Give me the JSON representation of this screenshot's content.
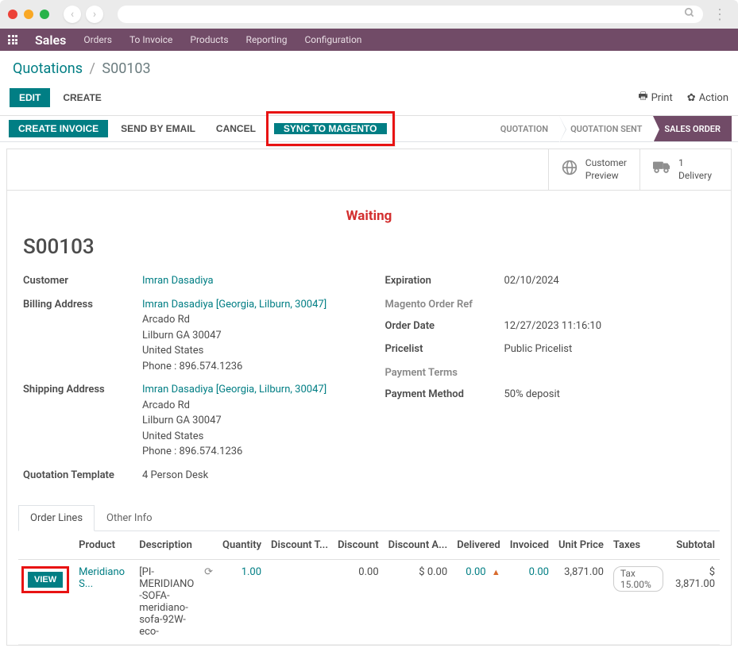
{
  "topnav": {
    "brand": "Sales",
    "items": [
      "Orders",
      "To Invoice",
      "Products",
      "Reporting",
      "Configuration"
    ]
  },
  "breadcrumb": {
    "root": "Quotations",
    "current": "S00103"
  },
  "controls": {
    "edit": "EDIT",
    "create": "CREATE",
    "print": "Print",
    "action": "Action"
  },
  "actions": {
    "create_invoice": "CREATE INVOICE",
    "send_email": "SEND BY EMAIL",
    "cancel": "CANCEL",
    "sync": "SYNC TO MAGENTO"
  },
  "status_steps": {
    "quotation": "QUOTATION",
    "sent": "QUOTATION SENT",
    "order": "SALES ORDER"
  },
  "sheet_header": {
    "preview_label": "Customer",
    "preview_sub": "Preview",
    "delivery_count": "1",
    "delivery_label": "Delivery"
  },
  "waiting": "Waiting",
  "order_name": "S00103",
  "fields": {
    "customer_label": "Customer",
    "customer_value": "Imran Dasadiya",
    "billing_label": "Billing Address",
    "shipping_label": "Shipping Address",
    "addr_name_link": "Imran Dasadiya",
    "addr_sub": "[Georgia, Lilburn, 30047]",
    "addr_line1": "Arcado Rd",
    "addr_line2": "Lilburn GA 30047",
    "addr_country": "United States",
    "addr_phone": "Phone : 896.574.1236",
    "template_label": "Quotation Template",
    "template_value": "4 Person Desk",
    "expiration_label": "Expiration",
    "expiration_value": "02/10/2024",
    "magento_ref_label": "Magento Order Ref",
    "order_date_label": "Order Date",
    "order_date_value": "12/27/2023 11:16:10",
    "pricelist_label": "Pricelist",
    "pricelist_value": "Public Pricelist",
    "payment_terms_label": "Payment Terms",
    "payment_method_label": "Payment Method",
    "payment_method_value": "50% deposit"
  },
  "tabs": {
    "order_lines": "Order Lines",
    "other_info": "Other Info"
  },
  "table": {
    "headers": {
      "product": "Product",
      "description": "Description",
      "quantity": "Quantity",
      "discount_t": "Discount T...",
      "discount": "Discount",
      "discount_a": "Discount A...",
      "delivered": "Delivered",
      "invoiced": "Invoiced",
      "unit_price": "Unit Price",
      "taxes": "Taxes",
      "subtotal": "Subtotal"
    },
    "row": {
      "view": "VIEW",
      "product": "Meridiano S...",
      "description": "[PI-MERIDIANO-SOFA-meridiano-sofa-92W-eco-",
      "quantity": "1.00",
      "discount": "0.00",
      "discount_a": "$ 0.00",
      "delivered": "0.00",
      "invoiced": "0.00",
      "unit_price": "3,871.00",
      "taxes": "Tax 15.00%",
      "subtotal": "$ 3,871.00"
    }
  }
}
